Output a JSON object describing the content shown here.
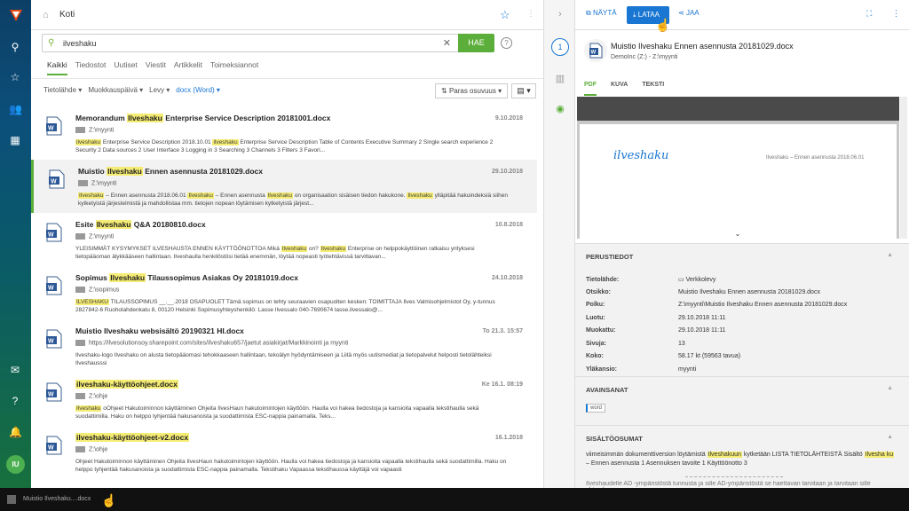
{
  "nav": {
    "logo_icon": "ilveshaku-logo",
    "items": [
      "search-icon",
      "star-icon",
      "people-icon",
      "apps-icon"
    ],
    "bottom_items": [
      "chat-icon",
      "help-icon",
      "bell-icon"
    ],
    "avatar": "IU"
  },
  "header": {
    "title": "Koti"
  },
  "search": {
    "value": "ilveshaku",
    "button": "HAE",
    "help": "?"
  },
  "tabs": [
    "Kaikki",
    "Tiedostot",
    "Uutiset",
    "Viestit",
    "Artikkelit",
    "Toimeksiannot"
  ],
  "filters": {
    "items": [
      "Tietolähde",
      "Muokkauspäivä",
      "Levy"
    ],
    "active": "docx (Word)",
    "sort": "Paras osuvuus"
  },
  "results": [
    {
      "title_pre": "Memorandum ",
      "title_hl": "Ilveshaku",
      "title_post": " Enterprise Service Description 20181001.docx",
      "date": "9.10.2018",
      "path": "Z:\\myynti",
      "snip": [
        [
          "ilveshaku",
          true
        ],
        [
          " Enterprise Service Description 2018.10.01 ",
          false
        ],
        [
          "ilveshaku",
          true
        ],
        [
          " Enterprise Service Description Table of Contents Executive Summary 2 Single search experience 2 Security 2 Data sources 2 User Interface 3 Logging in 3 Searching 3 Channels 3 Filters 3 Favori...",
          false
        ]
      ]
    },
    {
      "title_pre": "Muistio ",
      "title_hl": "Ilveshaku",
      "title_post": " Ennen asennusta 20181029.docx",
      "date": "29.10.2018",
      "path": "Z:\\myynti",
      "snip": [
        [
          "Ilveshaku",
          true
        ],
        [
          " – Ennen asennusta 2018.06.01 ",
          false
        ],
        [
          "Ilveshaku",
          true
        ],
        [
          " – Ennen asennusta ",
          false
        ],
        [
          "Ilveshaku",
          true
        ],
        [
          " on organisaation sisäisen tiedon hakukone. ",
          false
        ],
        [
          "Ilveshaku",
          true
        ],
        [
          " ylläpitää hakuindeksiä siihen kytketyistä järjestelmistä ja mahdollistaa mm. tietojen nopean löytämisen kytketyistä järjest...",
          false
        ]
      ]
    },
    {
      "title_pre": "Esite ",
      "title_hl": "Ilveshaku",
      "title_post": " Q&A 20180810.docx",
      "date": "10.8.2018",
      "path": "Z:\\myynti",
      "snip": [
        [
          "YLEISIMMÄT KYSYMYKSET ILVESHAUSTA ENNEN KÄYTTÖÖNOTTOA Mikä ",
          false
        ],
        [
          "Ilveshaku",
          true
        ],
        [
          " on? ",
          false
        ],
        [
          "Ilveshaku",
          true
        ],
        [
          " Enterprise on helppokäyttöinen ratkaisu yrityksesi tietopääoman älykkääseen hallintaan. Ilveshaulla henkilöstösi tietää enemmän, löytää nopeasti työtehtävissä tarvittavan...",
          false
        ]
      ]
    },
    {
      "title_pre": "Sopimus ",
      "title_hl": "Ilveshaku",
      "title_post": " Tilaussopimus Asiakas Oy 20181019.docx",
      "date": "24.10.2018",
      "path": "Z:\\sopimus",
      "snip": [
        [
          "ILVESHAKU",
          true
        ],
        [
          " TILAUSSOPIMUS __.__.2018 OSAPUOLET Tämä sopimus on tehty seuraavien osapuolten kesken: TOIMITTAJA Ilves Valmisohjelmistot Oy, y-tunnus 2827842-6 Ruoholahdenkatu 8, 00120 Helsinki Sopimusyhteyshenkilö: Lasse Ilvessalo 040-7690674 lasse.ilvessalo@...",
          false
        ]
      ]
    },
    {
      "title_pre": "Muistio Ilveshaku websisältö 20190321 HI.docx",
      "title_hl": "",
      "title_post": "",
      "date": "To 21.3. 15:57",
      "path": "https://ilvesolutionsoy.sharepoint.com/sites/ilveshaku657/jaetut asiakirjat/Markkinointi ja myynti",
      "snip": [
        [
          "Ilveshaku-logo Ilveshaku on alusta tietopääomasi tehokkaaseen hallintaan, tekoälyn hyödyntämiseen ja Liitä myös uutismediat ja tietopalvelut helposti tietolähteiksi Ilveshausssi",
          false
        ]
      ]
    },
    {
      "title_pre": "",
      "title_hl": "ilveshaku-käyttöohjeet.docx",
      "title_post": "",
      "date": "Ke 16.1. 08:19",
      "path": "Z:\\ohje",
      "snip": [
        [
          "Ilveshaku",
          true
        ],
        [
          " oOhjeet Hakutoiminnon käyttäminen Ohjeita IlvesHaun hakutoimintojen käyttöön. Haulla voi hakea tiedostoja ja kansioita vapaalla tekstihaulla sekä suodattimilla. Haku on helppo tyhjentää hakusanoista ja suodattimista ESC-nappia painamalla. Teks...",
          false
        ]
      ]
    },
    {
      "title_pre": "",
      "title_hl": "ilveshaku-käyttöohjeet-v2.docx",
      "title_post": "",
      "date": "16.1.2018",
      "path": "Z:\\ohje",
      "snip": [
        [
          "Ohjeet Hakutoiminnon käyttäminen Ohjeita IlvesHaun hakutoimintojen käyttöön. Haulla voi hakea tiedostoja ja kansioita vapaalla tekstihaulla sekä suodattimilla. Haku on helppo tyhjentää hakusanoista ja suodattimista ESC-nappia painamalla. Tekstihaku Vapaassa tekstihaussa käyttäjä voi vapaasti",
          false
        ]
      ]
    }
  ],
  "rail": {
    "badge": "1"
  },
  "preview": {
    "actions": {
      "show": "NÄYTÄ",
      "download": "LATAA",
      "share": "JAA"
    },
    "title": "Muistio Ilveshaku Ennen asennusta 20181029.docx",
    "subtitle": "DemoInc (Z:) - Z:\\myynti",
    "tabs": [
      "PDF",
      "KUVA",
      "TEKSTI"
    ],
    "page_logo": "ilveshaku",
    "page_header": "Ilveshaku – Ennen asennusta 2018.06.01"
  },
  "details": {
    "heading": "PERUSTIEDOT",
    "rows": [
      {
        "k": "Tietolähde:",
        "v": "Verkkolevy"
      },
      {
        "k": "Otsikko:",
        "v": "Muistio Ilveshaku Ennen asennusta 20181029.docx"
      },
      {
        "k": "Polku:",
        "v": "Z:\\myynti\\Muistio Ilveshaku Ennen asennusta 20181029.docx"
      },
      {
        "k": "Luotu:",
        "v": "29.10.2018 11:11"
      },
      {
        "k": "Muokattu:",
        "v": "29.10.2018 11:11"
      },
      {
        "k": "Sivuja:",
        "v": "13"
      },
      {
        "k": "Koko:",
        "v": "58.17 kt (59563 tavua)"
      },
      {
        "k": "Yläkansio:",
        "v": "myynti"
      }
    ]
  },
  "keywords": {
    "heading": "AVAINSANAT",
    "tag": "word"
  },
  "matches": {
    "heading": "SISÄLTÖOSUMAT",
    "snip": [
      [
        "viimeisimmän dokumenttiversion löytämistä ",
        false
      ],
      [
        "Ilveshakuun",
        true
      ],
      [
        " kytketään LISTA TIETOLÄHTEISTÄ Sisältö ",
        false
      ],
      [
        "Ilvesha ku",
        true
      ],
      [
        " – Ennen asennusta 1 Asennuksen tavoite 1 Käyttöönotto 3",
        false
      ]
    ],
    "snip2": "Ilveshaudelle AD -ympäristöstä tunnusta ja sille AD-ympäristöstä se haettavan tarvitaan ja tarvitaan sille yhteyden"
  },
  "taskbar": {
    "item": "Muistio Ilveshaku....docx"
  }
}
